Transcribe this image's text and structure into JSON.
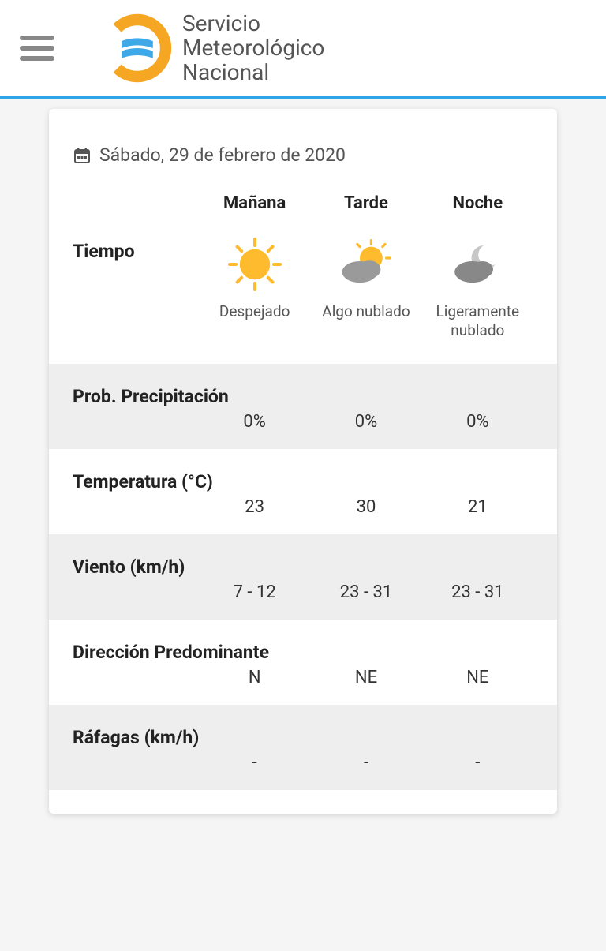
{
  "header": {
    "org_line1": "Servicio",
    "org_line2": "Meteorológico",
    "org_line3": "Nacional"
  },
  "forecast": {
    "date": "Sábado, 29 de febrero de 2020",
    "columns": {
      "morning": "Mañana",
      "afternoon": "Tarde",
      "night": "Noche"
    },
    "rows": {
      "weather": {
        "label": "Tiempo",
        "values": {
          "morning": "Despejado",
          "afternoon": "Algo nublado",
          "night": "Ligeramente nublado"
        }
      },
      "precip": {
        "label": "Prob. Precipitación",
        "values": {
          "morning": "0%",
          "afternoon": "0%",
          "night": "0%"
        }
      },
      "temp": {
        "label": "Temperatura (°C)",
        "values": {
          "morning": "23",
          "afternoon": "30",
          "night": "21"
        }
      },
      "wind": {
        "label": "Viento (km/h)",
        "values": {
          "morning": "7 - 12",
          "afternoon": "23 - 31",
          "night": "23 - 31"
        }
      },
      "direction": {
        "label": "Dirección Predominante",
        "values": {
          "morning": "N",
          "afternoon": "NE",
          "night": "NE"
        }
      },
      "gusts": {
        "label": "Ráfagas (km/h)",
        "values": {
          "morning": "-",
          "afternoon": "-",
          "night": "-"
        }
      }
    }
  }
}
